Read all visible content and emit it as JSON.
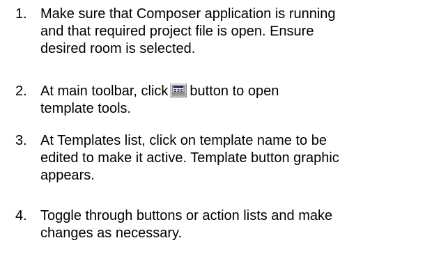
{
  "steps": [
    {
      "number": "1.",
      "lines": [
        "Make sure that Composer application is running",
        "and that required project file is open. Ensure",
        "desired room is selected."
      ]
    },
    {
      "number": "2.",
      "before_icon": "At main toolbar, click",
      "icon": "template-tools-icon",
      "after_icon": "button to open",
      "lines": [
        "template tools."
      ]
    },
    {
      "number": "3.",
      "lines": [
        "At Templates list, click on template name to be",
        "edited to make it active. Template button graphic",
        "appears."
      ]
    },
    {
      "number": "4.",
      "lines": [
        "Toggle through buttons or action lists and make",
        "changes as necessary."
      ]
    }
  ]
}
